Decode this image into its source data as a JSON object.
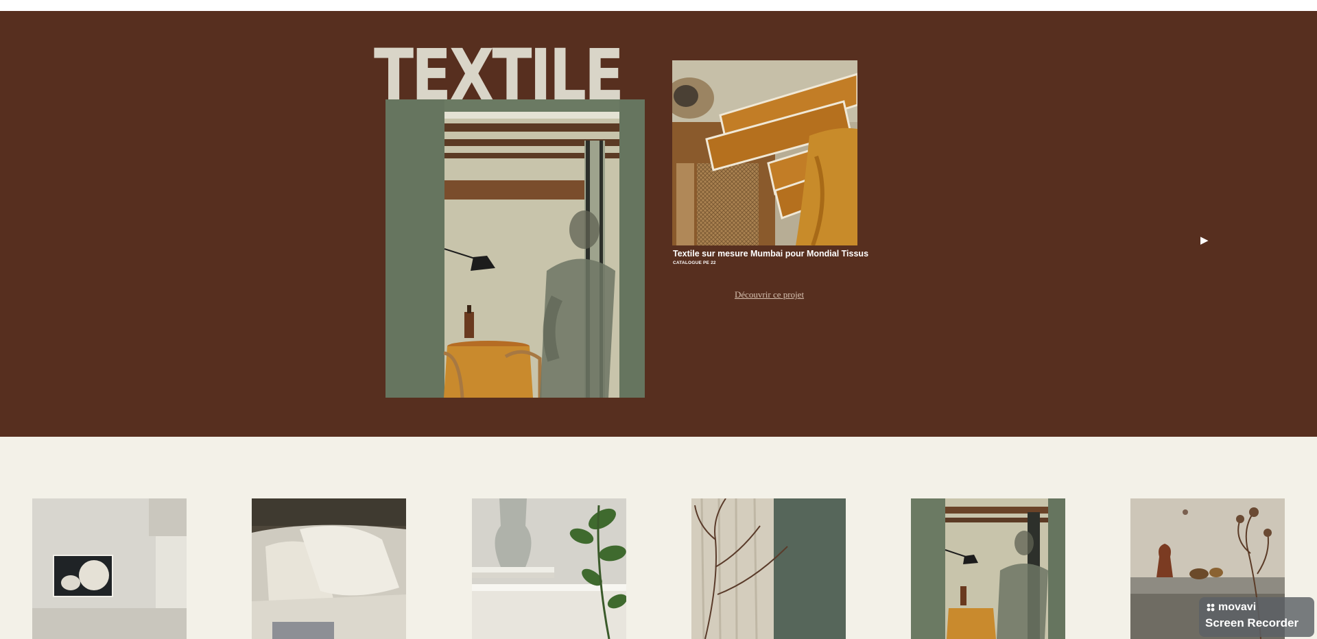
{
  "hero": {
    "title": "TEXTILE",
    "project": {
      "title": "Textile sur mesure Mumbai pour Mondial Tissus",
      "subtitle": "CATALOGUE PE 22",
      "link_label": "Découvrir ce projet"
    },
    "next_arrow": "▶"
  },
  "colors": {
    "hero_background": "#572f1f",
    "page_background": "#f3f1e8",
    "title_color": "#d9d5c8"
  },
  "gallery": {
    "count": 6
  },
  "recorder_badge": {
    "brand": "movavi",
    "product": "Screen Recorder"
  }
}
